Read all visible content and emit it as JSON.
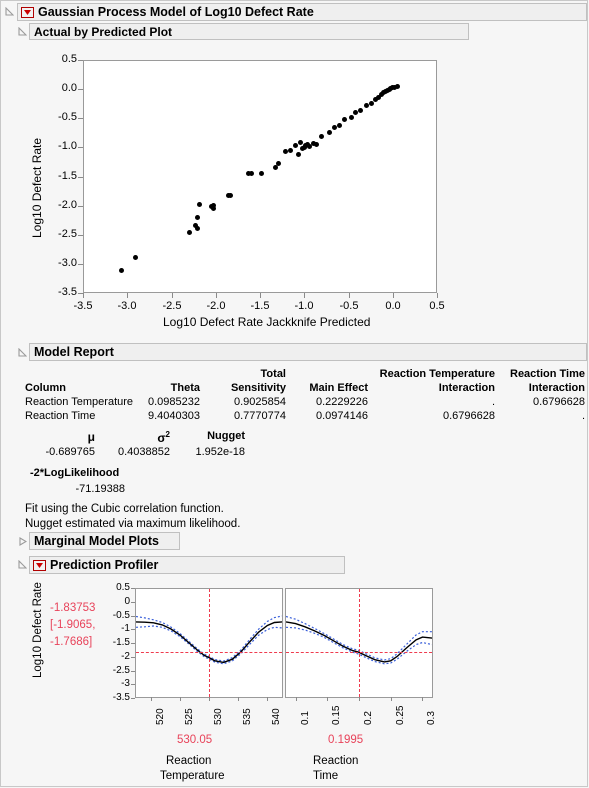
{
  "window": {
    "outer_title": "Gaussian Process Model of Log10 Defect Rate",
    "sections": {
      "actual_by_predicted": "Actual by Predicted Plot",
      "model_report": "Model Report",
      "marginal_model_plots": "Marginal Model Plots",
      "prediction_profiler": "Prediction Profiler"
    }
  },
  "colors": {
    "red_accent": "#e8435a",
    "curve": "#000000",
    "confidence_band": "#3a5fd9",
    "title_bar": "#efefef",
    "plot_background": "#ffffff"
  },
  "chart_data": [
    {
      "type": "scatter",
      "title": "Actual by Predicted Plot",
      "xlabel": "Log10 Defect Rate Jackknife Predicted",
      "ylabel": "Log10 Defect Rate",
      "xlim": [
        -3.5,
        0.5
      ],
      "ylim": [
        -3.5,
        0.5
      ],
      "xticks": [
        -3.5,
        -3.0,
        -2.5,
        -2.0,
        -1.5,
        -1.0,
        -0.5,
        0.0,
        0.5
      ],
      "yticks": [
        0.5,
        0.0,
        -0.5,
        -1.0,
        -1.5,
        -2.0,
        -2.5,
        -3.0,
        -3.5
      ],
      "xtick_labels": [
        "-3.5",
        "-3.0",
        "-2.5",
        "-2.0",
        "-1.5",
        "-1.0",
        "-0.5",
        "0.0",
        "0.5"
      ],
      "ytick_labels": [
        "0.5",
        "0.0",
        "-0.5",
        "-1.0",
        "-1.5",
        "-2.0",
        "-2.5",
        "-3.0",
        "-3.5"
      ],
      "grid": false,
      "points": [
        [
          -3.06,
          -3.11
        ],
        [
          -2.91,
          -2.89
        ],
        [
          -2.3,
          -2.46
        ],
        [
          -2.23,
          -2.34
        ],
        [
          -2.21,
          -2.39
        ],
        [
          -2.21,
          -2.2
        ],
        [
          -2.18,
          -1.98
        ],
        [
          -2.05,
          -2.02
        ],
        [
          -2.02,
          -1.99
        ],
        [
          -2.02,
          -2.05
        ],
        [
          -1.86,
          -1.82
        ],
        [
          -1.83,
          -1.82
        ],
        [
          -1.63,
          -1.45
        ],
        [
          -1.6,
          -1.45
        ],
        [
          -1.48,
          -1.44
        ],
        [
          -1.33,
          -1.35
        ],
        [
          -1.29,
          -1.27
        ],
        [
          -1.21,
          -1.07
        ],
        [
          -1.15,
          -1.06
        ],
        [
          -1.1,
          -0.96
        ],
        [
          -1.07,
          -1.13
        ],
        [
          -1.04,
          -0.92
        ],
        [
          -1.02,
          -1.02
        ],
        [
          -1.0,
          -1.0
        ],
        [
          -0.99,
          -0.97
        ],
        [
          -0.96,
          -0.95
        ],
        [
          -0.94,
          -0.99
        ],
        [
          -0.9,
          -0.93
        ],
        [
          -0.86,
          -0.95
        ],
        [
          -0.8,
          -0.82
        ],
        [
          -0.72,
          -0.74
        ],
        [
          -0.66,
          -0.66
        ],
        [
          -0.6,
          -0.62
        ],
        [
          -0.54,
          -0.52
        ],
        [
          -0.47,
          -0.49
        ],
        [
          -0.42,
          -0.4
        ],
        [
          -0.36,
          -0.36
        ],
        [
          -0.3,
          -0.28
        ],
        [
          -0.24,
          -0.24
        ],
        [
          -0.2,
          -0.17
        ],
        [
          -0.16,
          -0.14
        ],
        [
          -0.13,
          -0.1
        ],
        [
          -0.1,
          -0.06
        ],
        [
          -0.08,
          -0.04
        ],
        [
          -0.06,
          -0.02
        ],
        [
          -0.04,
          -0.01
        ],
        [
          -0.02,
          0.01
        ],
        [
          0.0,
          0.02
        ],
        [
          0.02,
          0.03
        ],
        [
          0.05,
          0.04
        ]
      ]
    },
    {
      "type": "line",
      "title": "Prediction Profiler - Reaction Temperature",
      "xlabel": "Reaction Temperature",
      "ylabel": "Log10 Defect Rate",
      "xlim": [
        517.5,
        542.5
      ],
      "ylim": [
        -3.5,
        0.5
      ],
      "xticks": [
        520,
        525,
        530,
        535,
        540
      ],
      "xtick_labels": [
        "520",
        "525",
        "530",
        "535",
        "540"
      ],
      "yticks": [
        0.5,
        0,
        -0.5,
        -1,
        -1.5,
        -2,
        -2.5,
        -3,
        -3.5
      ],
      "ytick_labels": [
        "0.5",
        "0",
        "-0.5",
        "-1",
        "-1.5",
        "-2",
        "-2.5",
        "-3",
        "-3.5"
      ],
      "current_x": 530.05,
      "current_y": -1.83753,
      "x": [
        517.5,
        519,
        520.5,
        522,
        523.5,
        525,
        526.5,
        528,
        529.2,
        530.05,
        531,
        532.5,
        534,
        535.5,
        537,
        538.5,
        540,
        541.2,
        542.5
      ],
      "y": [
        -0.72,
        -0.73,
        -0.75,
        -0.83,
        -0.98,
        -1.2,
        -1.48,
        -1.76,
        -1.96,
        -2.05,
        -2.16,
        -2.22,
        -2.1,
        -1.82,
        -1.45,
        -1.1,
        -0.85,
        -0.74,
        -0.72
      ],
      "y_upper": [
        -0.52,
        -0.57,
        -0.64,
        -0.74,
        -0.91,
        -1.14,
        -1.43,
        -1.71,
        -1.91,
        -2.0,
        -2.11,
        -2.17,
        -2.04,
        -1.75,
        -1.36,
        -0.99,
        -0.7,
        -0.56,
        -0.5
      ],
      "y_lower": [
        -0.92,
        -0.9,
        -0.87,
        -0.92,
        -1.05,
        -1.26,
        -1.53,
        -1.81,
        -2.01,
        -2.1,
        -2.21,
        -2.27,
        -2.16,
        -1.89,
        -1.54,
        -1.21,
        -1.0,
        -0.92,
        -0.94
      ]
    },
    {
      "type": "line",
      "title": "Prediction Profiler - Reaction Time",
      "xlabel": "Reaction Time",
      "ylabel": "Log10 Defect Rate",
      "xlim": [
        0.085,
        0.315
      ],
      "ylim": [
        -3.5,
        0.5
      ],
      "xticks": [
        0.1,
        0.15,
        0.2,
        0.25,
        0.3
      ],
      "xtick_labels": [
        "0.1",
        "0.15",
        "0.2",
        "0.25",
        "0.3"
      ],
      "current_x": 0.1995,
      "current_y": -1.83753,
      "x": [
        0.085,
        0.1,
        0.115,
        0.13,
        0.145,
        0.16,
        0.175,
        0.19,
        0.1995,
        0.21,
        0.225,
        0.24,
        0.25,
        0.26,
        0.275,
        0.29,
        0.3,
        0.315
      ],
      "y": [
        -0.72,
        -0.78,
        -0.9,
        -1.05,
        -1.22,
        -1.42,
        -1.62,
        -1.78,
        -1.84,
        -1.96,
        -2.12,
        -2.2,
        -2.16,
        -2.0,
        -1.68,
        -1.38,
        -1.28,
        -1.32
      ],
      "y_upper": [
        -0.52,
        -0.62,
        -0.78,
        -0.96,
        -1.15,
        -1.35,
        -1.56,
        -1.72,
        -1.77,
        -1.89,
        -2.05,
        -2.13,
        -2.08,
        -1.9,
        -1.55,
        -1.2,
        -1.08,
        -1.08
      ],
      "y_lower": [
        -0.92,
        -0.94,
        -1.02,
        -1.14,
        -1.29,
        -1.49,
        -1.68,
        -1.84,
        -1.91,
        -2.03,
        -2.19,
        -2.27,
        -2.24,
        -2.1,
        -1.81,
        -1.56,
        -1.48,
        -1.56
      ]
    }
  ],
  "model_report": {
    "headers": {
      "column": "Column",
      "theta": "Theta",
      "total_sensitivity_line1": "Total",
      "total_sensitivity_line2": "Sensitivity",
      "main_effect": "Main Effect",
      "reaction_temperature_interaction_line1": "Reaction Temperature",
      "reaction_temperature_interaction_line2": "Interaction",
      "reaction_time_interaction_line1": "Reaction Time",
      "reaction_time_interaction_line2": "Interaction"
    },
    "rows": [
      {
        "column": "Reaction Temperature",
        "theta": "0.0985232",
        "total_sensitivity": "0.9025854",
        "main_effect": "0.2229226",
        "reaction_temperature_interaction": ".",
        "reaction_time_interaction": "0.6796628"
      },
      {
        "column": "Reaction Time",
        "theta": "9.4040303",
        "total_sensitivity": "0.7770774",
        "main_effect": "0.0974146",
        "reaction_temperature_interaction": "0.6796628",
        "reaction_time_interaction": "."
      }
    ],
    "stats": {
      "mu_label": "μ",
      "sigma2_label": "σ",
      "sigma2_sup": "2",
      "nugget_label": "Nugget",
      "mu_value": "-0.689765",
      "sigma2_value": "0.4038852",
      "nugget_value": "1.952e-18",
      "loglik_label": "-2*LogLikelihood",
      "loglik_value": "-71.19388"
    },
    "notes": [
      "Fit using the Cubic correlation function.",
      "Nugget estimated via maximum likelihood."
    ]
  },
  "profiler": {
    "y_axis_title": "Log10 Defect Rate",
    "prediction_value": "-1.83753",
    "ci_line1": "[-1.9065,",
    "ci_line2": "-1.7686]",
    "factors": [
      {
        "setting": "530.05",
        "name_line1": "Reaction",
        "name_line2": "Temperature"
      },
      {
        "setting": "0.1995",
        "name_line1": "Reaction",
        "name_line2": "Time"
      }
    ]
  }
}
